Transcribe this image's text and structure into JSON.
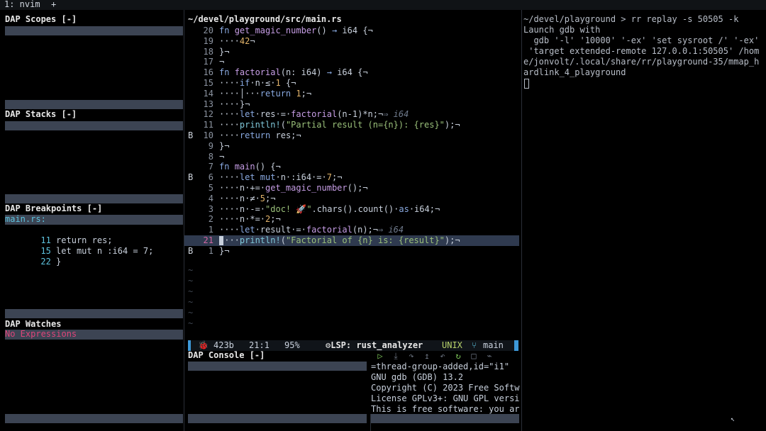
{
  "tmux": {
    "tab": "1: nvim",
    "plus": "+"
  },
  "left_panes": {
    "scopes": {
      "title": "DAP Scopes [-]"
    },
    "stacks": {
      "title": "DAP Stacks [-]"
    },
    "breakpoints": {
      "title": "DAP Breakpoints [-]",
      "file": "main.rs:",
      "items": [
        {
          "line": "11",
          "text": "return res;"
        },
        {
          "line": "15",
          "text": "let mut n :i64 = 7;"
        },
        {
          "line": "22",
          "text": "}"
        }
      ]
    },
    "watches": {
      "title": "DAP Watches",
      "empty": "No Expressions"
    }
  },
  "editor": {
    "path": "~/devel/playground/src/main.rs",
    "lines": [
      {
        "sign": "",
        "num": "20",
        "code": [
          [
            "kw",
            "fn "
          ],
          [
            "fn",
            "get_magic_number"
          ],
          [
            "",
            "() "
          ],
          [
            "kw",
            "→"
          ],
          [
            "",
            " i64 {¬"
          ]
        ]
      },
      {
        "sign": "",
        "num": "19",
        "code": [
          [
            "",
            "····"
          ],
          [
            "num",
            "42"
          ],
          [
            "",
            "¬"
          ]
        ]
      },
      {
        "sign": "",
        "num": "18",
        "code": [
          [
            "",
            "}¬"
          ]
        ]
      },
      {
        "sign": "",
        "num": "17",
        "code": [
          [
            "",
            "¬"
          ]
        ]
      },
      {
        "sign": "",
        "num": "16",
        "code": [
          [
            "kw",
            "fn "
          ],
          [
            "fn",
            "factorial"
          ],
          [
            "",
            "(n: i64) "
          ],
          [
            "kw",
            "→"
          ],
          [
            "",
            " i64 {¬"
          ]
        ]
      },
      {
        "sign": "",
        "num": "15",
        "code": [
          [
            "",
            "····"
          ],
          [
            "kw",
            "if"
          ],
          [
            "",
            "·n·≤·"
          ],
          [
            "num",
            "1"
          ],
          [
            "",
            " {¬"
          ]
        ]
      },
      {
        "sign": "",
        "num": "14",
        "code": [
          [
            "",
            "····│···"
          ],
          [
            "kw",
            "return "
          ],
          [
            "num",
            "1"
          ],
          [
            "",
            ";¬"
          ]
        ]
      },
      {
        "sign": "",
        "num": "13",
        "code": [
          [
            "",
            "····}¬"
          ]
        ]
      },
      {
        "sign": "",
        "num": "12",
        "code": [
          [
            "",
            "····"
          ],
          [
            "kw",
            "let"
          ],
          [
            "",
            "·res·=·"
          ],
          [
            "fn",
            "factorial"
          ],
          [
            "",
            "(n-1)*n;¬"
          ],
          [
            "hint",
            "⇒ i64"
          ]
        ]
      },
      {
        "sign": "",
        "num": "11",
        "code": [
          [
            "",
            "····"
          ],
          [
            "mac",
            "println!"
          ],
          [
            "",
            "("
          ],
          [
            "str",
            "\"Partial result (n={n}): {res}\""
          ],
          [
            "",
            ");¬"
          ]
        ]
      },
      {
        "sign": "B",
        "num": "10",
        "code": [
          [
            "",
            "····"
          ],
          [
            "kw",
            "return"
          ],
          [
            "",
            " res;¬"
          ]
        ]
      },
      {
        "sign": "",
        "num": "9",
        "code": [
          [
            "",
            "}¬"
          ]
        ]
      },
      {
        "sign": "",
        "num": "8",
        "code": [
          [
            "",
            "¬"
          ]
        ]
      },
      {
        "sign": "",
        "num": "7",
        "code": [
          [
            "kw",
            "fn "
          ],
          [
            "fn",
            "main"
          ],
          [
            "",
            "() {¬"
          ]
        ]
      },
      {
        "sign": "B",
        "num": "6",
        "code": [
          [
            "",
            "····"
          ],
          [
            "kw",
            "let mut"
          ],
          [
            "",
            "·n·:i64·=·"
          ],
          [
            "num",
            "7"
          ],
          [
            "",
            ";¬"
          ]
        ]
      },
      {
        "sign": "",
        "num": "5",
        "code": [
          [
            "",
            "····n·+=·"
          ],
          [
            "fn",
            "get_magic_number"
          ],
          [
            "",
            "();¬"
          ]
        ]
      },
      {
        "sign": "",
        "num": "4",
        "code": [
          [
            "",
            "····n·≠·"
          ],
          [
            "num",
            "5"
          ],
          [
            "",
            ";¬"
          ]
        ]
      },
      {
        "sign": "",
        "num": "3",
        "code": [
          [
            "",
            "····n·-=·"
          ],
          [
            "str",
            "\"doc! 🚀\""
          ],
          [
            "",
            ".chars().count()·"
          ],
          [
            "kw",
            "as"
          ],
          [
            "",
            "·i64;¬"
          ]
        ]
      },
      {
        "sign": "",
        "num": "2",
        "code": [
          [
            "",
            "····n·*=·"
          ],
          [
            "num",
            "2"
          ],
          [
            "",
            ";¬"
          ]
        ]
      },
      {
        "sign": "",
        "num": "1",
        "code": [
          [
            "",
            "····"
          ],
          [
            "kw",
            "let"
          ],
          [
            "",
            "·result·=·"
          ],
          [
            "fn",
            "factorial"
          ],
          [
            "",
            "(n);¬"
          ],
          [
            "hint",
            "⇒ i64"
          ]
        ]
      },
      {
        "sign": "",
        "num": "21",
        "current": true,
        "code": [
          [
            "",
            "····"
          ],
          [
            "mac",
            "println!"
          ],
          [
            "",
            "("
          ],
          [
            "str",
            "\"Factorial of {n} is: {result}\""
          ],
          [
            "",
            ");¬"
          ]
        ]
      },
      {
        "sign": "B",
        "num": "1",
        "code": [
          [
            "",
            "}¬"
          ]
        ]
      }
    ]
  },
  "statusline": {
    "icon": "🐞",
    "size": "423b",
    "pos": "21:1",
    "percent": "95%",
    "lsp": "⚙LSP: rust_analyzer",
    "format": "UNIX",
    "branch": "main"
  },
  "dap_console": {
    "title": "DAP Console [-]",
    "lines": [
      "=thread-group-added,id=\"i1\"",
      "GNU gdb (GDB) 13.2",
      "Copyright (C) 2023 Free Softw",
      "License GPLv3+: GNU GPL versi",
      "This is free software: you ar"
    ]
  },
  "terminal": {
    "lines": [
      "~/devel/playground > rr replay -s 50505 -k",
      "Launch gdb with",
      "  gdb '-l' '10000' '-ex' 'set sysroot /' '-ex'",
      " 'target extended-remote 127.0.0.1:50505' /hom",
      "e/jonvolt/.local/share/rr/playground-35/mmap_h",
      "ardlink_4_playground"
    ]
  }
}
